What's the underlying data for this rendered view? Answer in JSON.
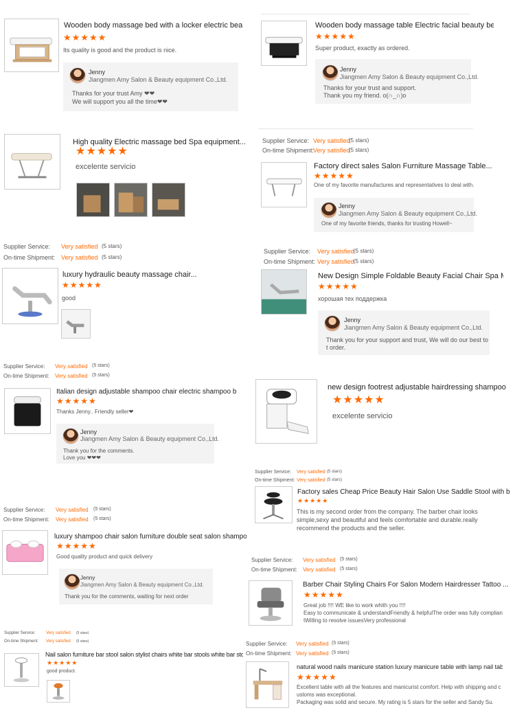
{
  "r1": {
    "title": "Wooden body massage bed with a locker electric beauty ...",
    "stars": "★★★★★",
    "review": "Its quality is good and the product is nice.",
    "reply_name": "Jenny",
    "reply_company": "Jiangmen Amy Salon & Beauty equipment Co.,Ltd.",
    "reply_line1": "Thanks for your trust  Amy  ❤❤",
    "reply_line2": "We will support you all the time❤❤"
  },
  "r2": {
    "title": "Wooden body massage table Electric facial beauty bed ...",
    "stars": "★★★★★",
    "review": "Super product, exactly as ordered.",
    "reply_name": "Jenny",
    "reply_company": "Jiangmen Amy Salon & Beauty equipment Co.,Ltd.",
    "reply_line1": "Thanks for your trust and support.",
    "reply_line2": "Thank you my friend.  o(∩_∩)o"
  },
  "r3": {
    "title": "High quality Electric massage bed Spa equipment...",
    "stars": "★★★★★",
    "review": "excelente servicio"
  },
  "r4": {
    "supplier_label": "Supplier Service:",
    "supplier_value": "Very satisfied",
    "supplier_stars": "(5 stars)",
    "shipment_label": "On-time Shipment:",
    "shipment_value": "Very satisfied",
    "shipment_stars": "(5 stars)",
    "title": "Factory direct sales Salon Furniture Massage Table...",
    "stars": "★★★★★",
    "review": "One of my favorite manufactures and representatives to deal with.",
    "reply_name": "Jenny",
    "reply_company": "Jiangmen Amy Salon & Beauty equipment Co.,Ltd.",
    "reply_line1": "One of my favorite friends, thanks for trusting Howell~"
  },
  "r5": {
    "supplier_label": "Supplier Service:",
    "supplier_value": "Very satisfied",
    "supplier_stars": "(5 stars)",
    "shipment_label": "On-time Shipment:",
    "shipment_value": "Very satisfied",
    "shipment_stars": "(5 stars)",
    "title": "luxury hydraulic beauty massage chair...",
    "stars": "★★★★★",
    "review": "good"
  },
  "r6": {
    "supplier_label": "Supplier Service:",
    "supplier_value": "Very satisfied",
    "supplier_stars": "(5 stars)",
    "shipment_label": "On-time Shipment:",
    "shipment_value": "Very satisfied",
    "shipment_stars": "(5 stars)",
    "title": "New Design Simple Foldable Beauty Facial Chair Spa Massage Bed",
    "stars": "★★★★★",
    "review": "хорошая тех поддержка",
    "reply_name": "Jenny",
    "reply_company": "Jiangmen Amy Salon & Beauty equipment Co.,Ltd.",
    "reply_line1": "Thank you for your support and trust,  We will do our best to serv",
    "reply_line2": "t order."
  },
  "r7": {
    "supplier_label": "Supplier Service:",
    "supplier_value": "Very satisfied",
    "supplier_stars": "(5 stars)",
    "shipment_label": "On-time Shipment:",
    "shipment_value": "Very satisfied",
    "shipment_stars": "(5 stars)",
    "title": "Italian design adjustable shampoo chair electric shampoo bowls...",
    "stars": "★★★★★",
    "review": "Thanks Jenny.. Friendly seller❤",
    "reply_name": "Jenny",
    "reply_company": "Jiangmen Amy Salon & Beauty equipment Co.,Ltd.",
    "reply_line1": "Thank you for the comments.",
    "reply_line2": "Love you ❤❤❤"
  },
  "r8": {
    "title": "new design footrest adjustable hairdressing shampoo unit",
    "stars": "★★★★★",
    "review": "excelente servicio"
  },
  "r9": {
    "supplier_label": "Supplier Service:",
    "supplier_value": "Very satisfied",
    "supplier_stars": "(5 stars)",
    "shipment_label": "On-time Shipment:",
    "shipment_value": "Very satisfied",
    "shipment_stars": "(5 stars)",
    "title": "Factory sales Cheap Price Beauty Hair Salon Use Saddle Stool with backrest...",
    "stars": "★★★★★",
    "review": "This is my second order from the company. The barber chair looks simple,sexy and beautiful and feels comfortable and durable.really recommend the products and the seller."
  },
  "r10": {
    "supplier_label": "Supplier Service:",
    "supplier_value": "Very satisfied",
    "supplier_stars": "(5 stars)",
    "shipment_label": "On-time Shipment:",
    "shipment_value": "Very satisfied",
    "shipment_stars": "(5 stars)",
    "title": "luxury shampoo chair salon furniture double seat salon shampoo chair",
    "stars": "★★★★★",
    "review": "Good quality product and quick delivery",
    "reply_name": "Jenny",
    "reply_company": "Jiangmen Amy Salon & Beauty equipment Co.,Ltd.",
    "reply_line1": "Thank you for the comments,  waiting for next order"
  },
  "r11": {
    "supplier_label": "Supplier Service:",
    "supplier_value": "Very satisfied",
    "supplier_stars": "(5 stars)",
    "shipment_label": "On-time Shipment:",
    "shipment_value": "Very satisfied",
    "shipment_stars": "(5 stars)",
    "title": "Barber Chair Styling Chairs For Salon Modern Hairdresser Tattoo ...",
    "stars": "★★★★★",
    "review_line1": "Great job !!!! WE like to work whith you !!!!",
    "review_line2": "Easy to communicate & understandFriendly & helpfulThe order was fully complian",
    "review_line3": "tWilling to resolve issuesVery professional"
  },
  "r12": {
    "supplier_label": "Supplier Service:",
    "supplier_value": "Very satisfied",
    "supplier_stars": "(5 stars)",
    "shipment_label": "On-time Shipment:",
    "shipment_value": "Very satisfied",
    "shipment_stars": "(5 stars)",
    "title": "Nail salon furniture bar stool salon stylist chairs white bar stools white bar stools",
    "stars": "★★★★★",
    "review": "good product."
  },
  "r13": {
    "supplier_label": "Supplier Service:",
    "supplier_value": "Very satisfied",
    "supplier_stars": "(5 stars)",
    "shipment_label": "On-time Shipment:",
    "shipment_value": "Very satisfied",
    "shipment_stars": "(5 stars)",
    "title": "natural wood nails manicure station luxury manicure table with lamp nail table",
    "stars": "★★★★★",
    "review_line1": "Excellent table with all the features and manicurist comfort. Help with shipping and c",
    "review_line2": "ustoms was exceptional.",
    "review_line3": "Packaging was solid and secure. My rating is 5 stars for the seller and Sandy Su."
  }
}
